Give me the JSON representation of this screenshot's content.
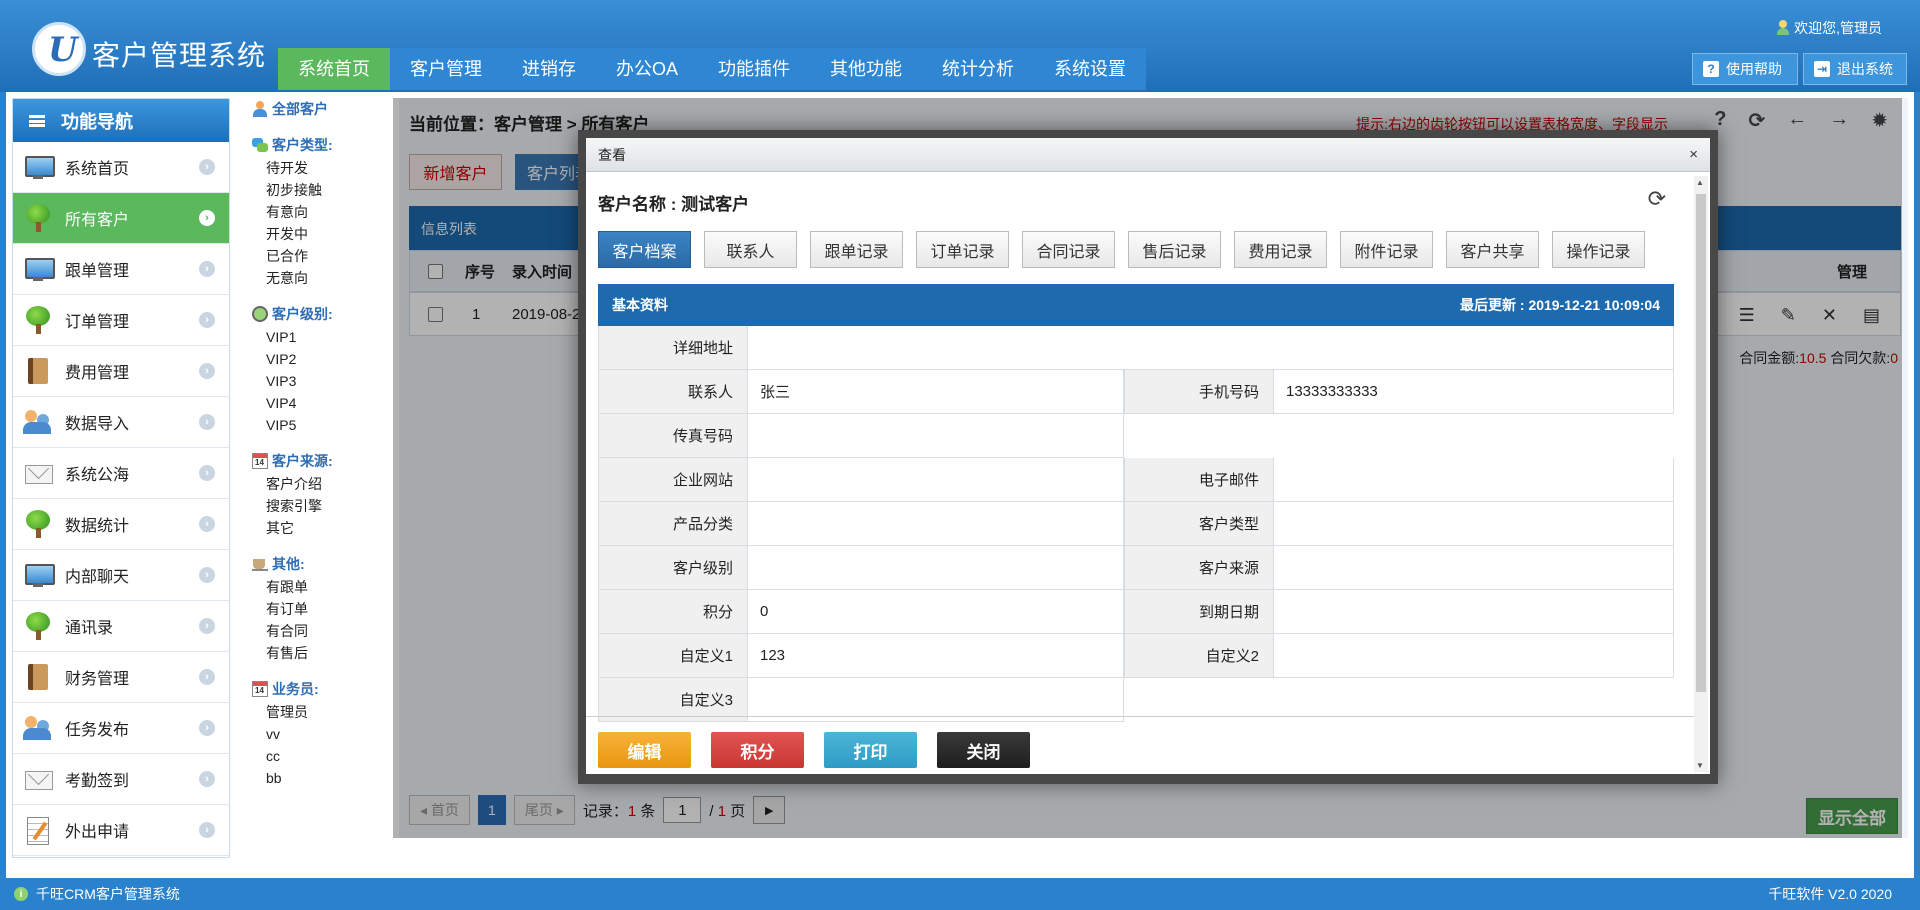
{
  "app": {
    "title": "客户管理系统",
    "welcome": "欢迎您,管理员",
    "help": "使用帮助",
    "logout": "退出系统"
  },
  "topnav": [
    "系统首页",
    "客户管理",
    "进销存",
    "办公OA",
    "功能插件",
    "其他功能",
    "统计分析",
    "系统设置"
  ],
  "sidebar": {
    "title": "功能导航",
    "items": [
      {
        "label": "系统首页",
        "icon": "monitor-icon"
      },
      {
        "label": "所有客户",
        "icon": "tree-icon"
      },
      {
        "label": "跟单管理",
        "icon": "monitor-icon"
      },
      {
        "label": "订单管理",
        "icon": "tree-icon"
      },
      {
        "label": "费用管理",
        "icon": "book-icon"
      },
      {
        "label": "数据导入",
        "icon": "people-icon"
      },
      {
        "label": "系统公海",
        "icon": "mail-icon"
      },
      {
        "label": "数据统计",
        "icon": "tree-icon"
      },
      {
        "label": "内部聊天",
        "icon": "monitor-icon"
      },
      {
        "label": "通讯录",
        "icon": "tree-icon"
      },
      {
        "label": "财务管理",
        "icon": "book-icon"
      },
      {
        "label": "任务发布",
        "icon": "people-icon"
      },
      {
        "label": "考勤签到",
        "icon": "mail-icon"
      },
      {
        "label": "外出申请",
        "icon": "note-icon"
      }
    ]
  },
  "filters": {
    "all": "全部客户",
    "type": {
      "title": "客户类型:",
      "items": [
        "待开发",
        "初步接触",
        "有意向",
        "开发中",
        "已合作",
        "无意向"
      ]
    },
    "level": {
      "title": "客户级别:",
      "items": [
        "VIP1",
        "VIP2",
        "VIP3",
        "VIP4",
        "VIP5"
      ]
    },
    "source": {
      "title": "客户来源:",
      "items": [
        "客户介绍",
        "搜索引擎",
        "其它"
      ]
    },
    "other": {
      "title": "其他:",
      "items": [
        "有跟单",
        "有订单",
        "有合同",
        "有售后"
      ]
    },
    "staff": {
      "title": "业务员:",
      "items": [
        "管理员",
        "vv",
        "cc",
        "bb"
      ]
    }
  },
  "content": {
    "crumb": "当前位置：客户管理 > 所有客户",
    "tip": "提示:右边的齿轮按钮可以设置表格宽度、字段显示",
    "add": "新增客户",
    "list": "客户列表",
    "table_title": "信息列表",
    "cols": {
      "seq": "序号",
      "time": "录入时间",
      "manage": "管理"
    },
    "row": {
      "seq": "1",
      "time": "2019-08-20"
    },
    "sum_contract_label": "合同金额:",
    "sum_contract": "10.5",
    "sum_debt_label": "合同欠款:",
    "sum_debt": "0",
    "pager": {
      "first": "◂ 首页",
      "page": "1",
      "last": "尾页 ▸",
      "records_label": "记录：",
      "records": "1",
      "unit": "条",
      "input": "1",
      "sep": "/",
      "total": "1",
      "page_unit": "页"
    },
    "show_all": "显示全部"
  },
  "modal": {
    "title": "查看",
    "close": "×",
    "customer_name": "客户名称 : 测试客户",
    "tabs": [
      "客户档案",
      "联系人",
      "跟单记录",
      "订单记录",
      "合同记录",
      "售后记录",
      "费用记录",
      "附件记录",
      "客户共享",
      "操作记录"
    ],
    "section": "基本资料",
    "updated": "最后更新 : 2019-12-21 10:09:04",
    "fields": {
      "address": {
        "label": "详细地址",
        "value": ""
      },
      "contact": {
        "label": "联系人",
        "value": "张三"
      },
      "mobile": {
        "label": "手机号码",
        "value": "13333333333"
      },
      "fax": {
        "label": "传真号码",
        "value": ""
      },
      "website": {
        "label": "企业网站",
        "value": ""
      },
      "email": {
        "label": "电子邮件",
        "value": ""
      },
      "product": {
        "label": "产品分类",
        "value": ""
      },
      "ctype": {
        "label": "客户类型",
        "value": ""
      },
      "clevel": {
        "label": "客户级别",
        "value": ""
      },
      "csource": {
        "label": "客户来源",
        "value": ""
      },
      "points": {
        "label": "积分",
        "value": "0"
      },
      "expire": {
        "label": "到期日期",
        "value": ""
      },
      "custom1": {
        "label": "自定义1",
        "value": "123"
      },
      "custom2": {
        "label": "自定义2",
        "value": ""
      },
      "custom3": {
        "label": "自定义3",
        "value": ""
      }
    },
    "actions": {
      "edit": "编辑",
      "points": "积分",
      "print": "打印",
      "close": "关闭"
    }
  },
  "footer": {
    "left": "千旺CRM客户管理系统",
    "right": "千旺软件 V2.0 2020"
  }
}
